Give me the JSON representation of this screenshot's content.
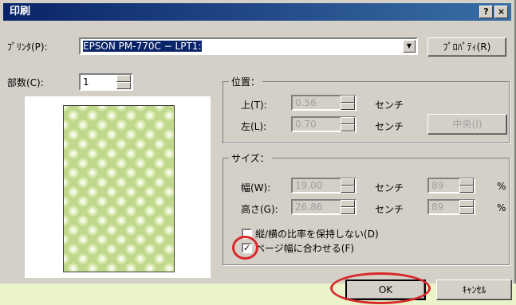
{
  "title": "印刷",
  "titlebar": {
    "help": "?",
    "close": "×"
  },
  "printer": {
    "label": "ﾌﾟﾘﾝﾀ(P):",
    "value": "EPSON PM-770C − LPT1:",
    "properties": "ﾌﾟﾛﾊﾟﾃｨ(R)"
  },
  "copies": {
    "label": "部数(C):",
    "value": "1"
  },
  "position": {
    "title": "位置：",
    "top_label": "上(T):",
    "top_value": "0.56",
    "top_unit": "センチ",
    "left_label": "左(L):",
    "left_value": "0.70",
    "left_unit": "センチ",
    "center": "中央(I)"
  },
  "size": {
    "title": "サイズ：",
    "width_label": "幅(W):",
    "width_value": "19.00",
    "width_unit": "センチ",
    "width_pct": "89",
    "pct": "%",
    "height_label": "高さ(G):",
    "height_value": "26.86",
    "height_unit": "センチ",
    "height_pct": "89"
  },
  "options": {
    "no_aspect": "縦/横の比率を保持しない(D)",
    "no_aspect_checked": false,
    "fit_width": "ページ幅に合わせる(F)",
    "fit_width_checked": true,
    "check_mark": "✓"
  },
  "buttons": {
    "ok": "OK",
    "cancel": "ｷｬﾝｾﾙ"
  },
  "colors": {
    "highlight": "#d8282a",
    "title": "#0a246a"
  }
}
